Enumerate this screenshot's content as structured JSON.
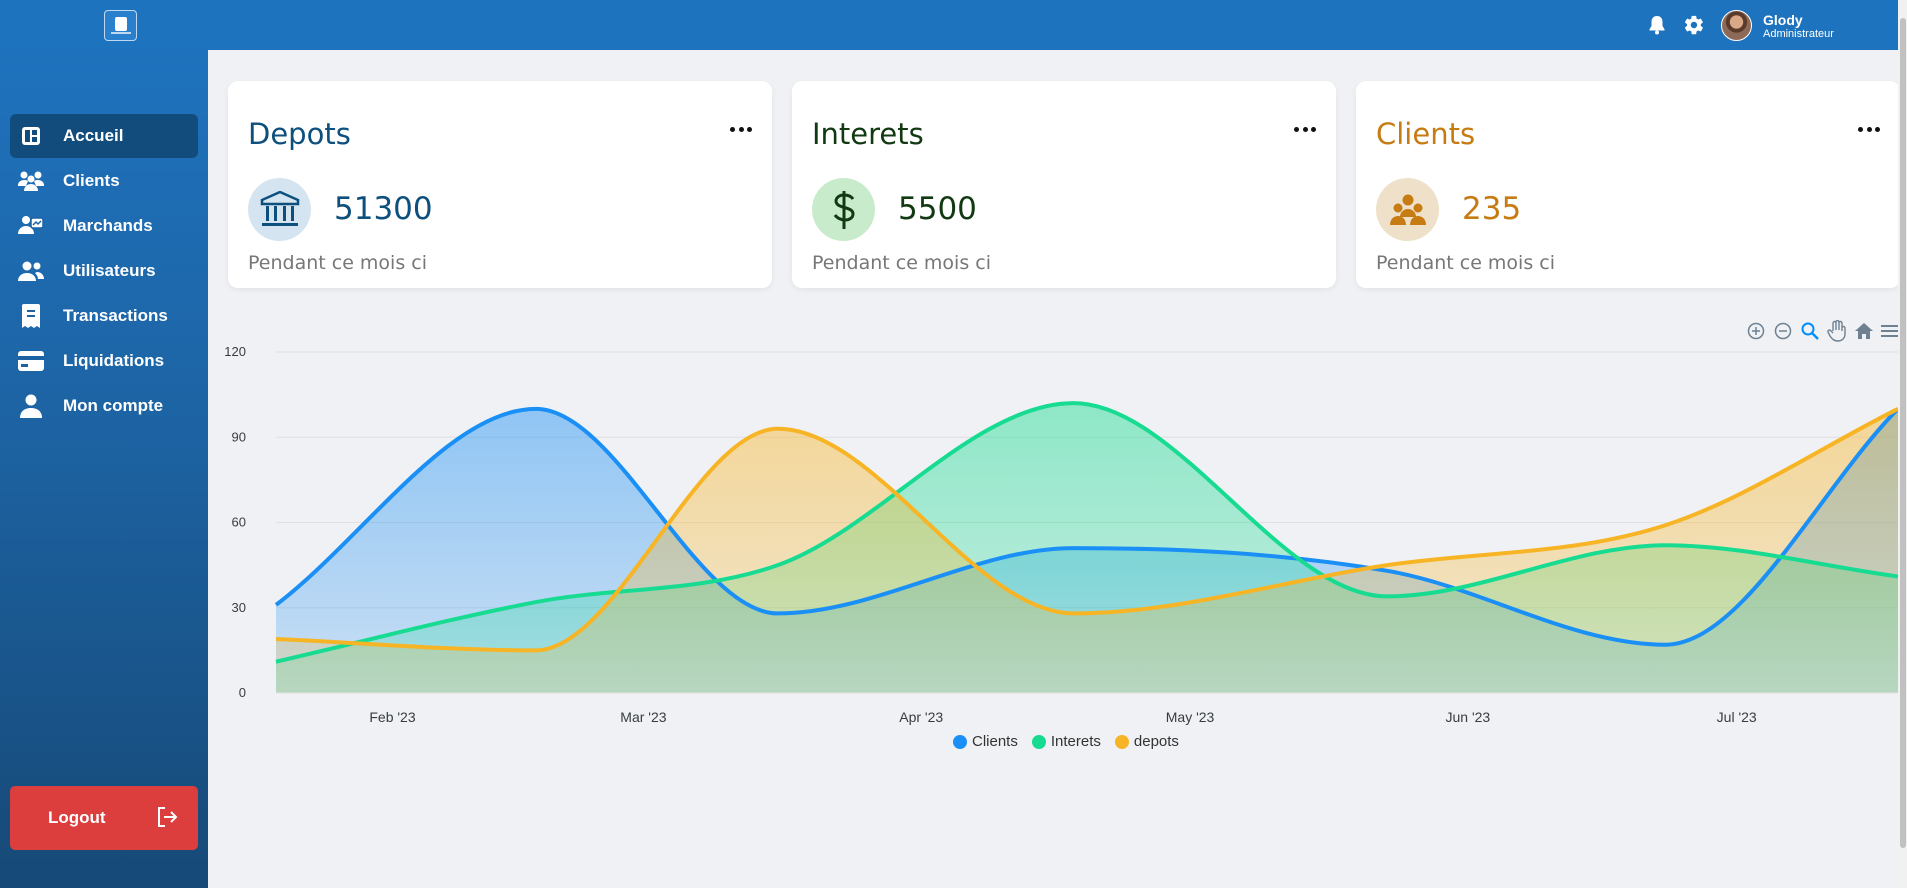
{
  "header": {
    "user_name": "Glody",
    "user_role": "Administrateur",
    "icons": [
      "bell-icon",
      "gear-icon"
    ]
  },
  "sidebar": {
    "items": [
      {
        "label": "Accueil",
        "icon": "dashboard-icon",
        "active": true
      },
      {
        "label": "Clients",
        "icon": "users-icon"
      },
      {
        "label": "Marchands",
        "icon": "merchant-icon"
      },
      {
        "label": "Utilisateurs",
        "icon": "user-group-icon"
      },
      {
        "label": "Transactions",
        "icon": "receipt-icon"
      },
      {
        "label": "Liquidations",
        "icon": "credit-card-icon"
      },
      {
        "label": "Mon compte",
        "icon": "person-icon"
      }
    ],
    "logout_label": "Logout"
  },
  "cards": [
    {
      "title": "Depots",
      "value": "51300",
      "subtitle": "Pendant ce mois ci",
      "icon": "bank-icon",
      "color": "#0d4f7d",
      "circle": "#d4e4f1"
    },
    {
      "title": "Interets",
      "value": "5500",
      "subtitle": "Pendant ce mois ci",
      "icon": "dollar-icon",
      "color": "#123a12",
      "circle": "#c8ebcc"
    },
    {
      "title": "Clients",
      "value": "235",
      "subtitle": "Pendant ce mois ci",
      "icon": "people-icon",
      "color": "#c77b13",
      "circle": "#eee0c9"
    }
  ],
  "chart_data": {
    "type": "area",
    "x": [
      "2023-01-19",
      "2023-02-17",
      "2023-03-16",
      "2023-04-18",
      "2023-05-23",
      "2023-06-23",
      "2023-07-19"
    ],
    "xticks": [
      "Feb '23",
      "Mar '23",
      "Apr '23",
      "May '23",
      "Jun '23",
      "Jul '23"
    ],
    "ylim": [
      0,
      120
    ],
    "yticks": [
      0,
      30,
      60,
      90,
      120
    ],
    "grid": true,
    "legend_position": "bottom",
    "series": [
      {
        "name": "Clients",
        "color": "#1a8ff5",
        "values": [
          31,
          100,
          28,
          51,
          43,
          17,
          100
        ]
      },
      {
        "name": "Interets",
        "color": "#16db91",
        "values": [
          11,
          32,
          45,
          102,
          34,
          52,
          41
        ]
      },
      {
        "name": "depots",
        "color": "#f7b425",
        "values": [
          19,
          15,
          93,
          28,
          45,
          59,
          100
        ]
      }
    ]
  }
}
